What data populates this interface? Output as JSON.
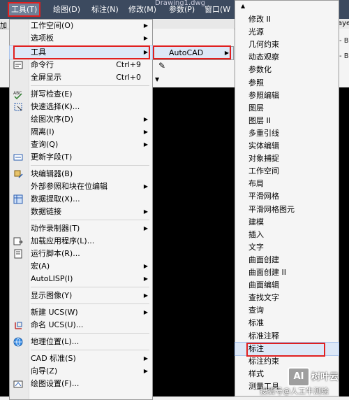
{
  "menubar": {
    "window_title": "Drawing1.dwg",
    "items": [
      "工具(T)",
      "绘图(D)",
      "标注(N)",
      "修改(M)",
      "参数(P)",
      "窗口(W"
    ]
  },
  "toolbar_strip": {
    "left_stub": "加",
    "right_stub": "aye"
  },
  "bg_right": [
    "- B",
    "- B"
  ],
  "tools_menu": {
    "items": [
      {
        "label": "工作空间(O)",
        "shortcut": "",
        "arrow": true,
        "icon": ""
      },
      {
        "label": "选项板",
        "shortcut": "",
        "arrow": true,
        "icon": ""
      },
      {
        "label": "工具",
        "shortcut": "",
        "arrow": true,
        "icon": ""
      },
      {
        "label": "命令行",
        "shortcut": "Ctrl+9",
        "arrow": false,
        "icon": "command-line-icon"
      },
      {
        "label": "全屏显示",
        "shortcut": "Ctrl+0",
        "arrow": false,
        "icon": ""
      },
      {
        "label": "拼写检查(E)",
        "shortcut": "",
        "arrow": false,
        "icon": "spell-check-icon"
      },
      {
        "label": "快速选择(K)...",
        "shortcut": "",
        "arrow": false,
        "icon": "quick-select-icon"
      },
      {
        "label": "绘图次序(D)",
        "shortcut": "",
        "arrow": true,
        "icon": ""
      },
      {
        "label": "隔离(I)",
        "shortcut": "",
        "arrow": true,
        "icon": ""
      },
      {
        "label": "查询(Q)",
        "shortcut": "",
        "arrow": true,
        "icon": ""
      },
      {
        "label": "更新字段(T)",
        "shortcut": "",
        "arrow": false,
        "icon": "update-field-icon"
      },
      {
        "label": "块编辑器(B)",
        "shortcut": "",
        "arrow": false,
        "icon": "block-editor-icon"
      },
      {
        "label": "外部参照和块在位编辑",
        "shortcut": "",
        "arrow": true,
        "icon": ""
      },
      {
        "label": "数据提取(X)...",
        "shortcut": "",
        "arrow": false,
        "icon": "data-extraction-icon"
      },
      {
        "label": "数据链接",
        "shortcut": "",
        "arrow": true,
        "icon": ""
      },
      {
        "label": "动作录制器(T)",
        "shortcut": "",
        "arrow": true,
        "icon": ""
      },
      {
        "label": "加载应用程序(L)...",
        "shortcut": "",
        "arrow": false,
        "icon": "load-application-icon"
      },
      {
        "label": "运行脚本(R)...",
        "shortcut": "",
        "arrow": false,
        "icon": "run-script-icon"
      },
      {
        "label": "宏(A)",
        "shortcut": "",
        "arrow": true,
        "icon": ""
      },
      {
        "label": "AutoLISP(I)",
        "shortcut": "",
        "arrow": true,
        "icon": ""
      },
      {
        "label": "显示图像(Y)",
        "shortcut": "",
        "arrow": true,
        "icon": ""
      },
      {
        "label": "新建 UCS(W)",
        "shortcut": "",
        "arrow": true,
        "icon": ""
      },
      {
        "label": "命名 UCS(U)...",
        "shortcut": "",
        "arrow": false,
        "icon": "named-ucs-icon"
      },
      {
        "label": "地理位置(L)...",
        "shortcut": "",
        "arrow": false,
        "icon": "globe-icon"
      },
      {
        "label": "CAD 标准(S)",
        "shortcut": "",
        "arrow": true,
        "icon": ""
      },
      {
        "label": "向导(Z)",
        "shortcut": "",
        "arrow": true,
        "icon": ""
      },
      {
        "label": "绘图设置(F)...",
        "shortcut": "",
        "arrow": false,
        "icon": "drafting-settings-icon"
      }
    ]
  },
  "autocad_submenu": {
    "label": "AutoCAD"
  },
  "toolbars_menu": {
    "items": [
      "修改 II",
      "光源",
      "几何约束",
      "动态观察",
      "参数化",
      "参照",
      "参照编辑",
      "图层",
      "图层 II",
      "多重引线",
      "实体编辑",
      "对象捕捉",
      "工作空间",
      "布局",
      "平滑网格",
      "平滑网格图元",
      "建模",
      "插入",
      "文字",
      "曲面创建",
      "曲面创建 II",
      "曲面编辑",
      "查找文字",
      "查询",
      "标准",
      "标准注释",
      "标注",
      "标注约束",
      "样式",
      "测量工具"
    ]
  },
  "watermark": {
    "logo": "AI",
    "brand": "树叶云",
    "sub": "搜狐号@人工牛测绘"
  },
  "colors": {
    "highlight_box": "#e02020",
    "menubar": "#3c4a5f",
    "hover": "#dde8f7"
  }
}
